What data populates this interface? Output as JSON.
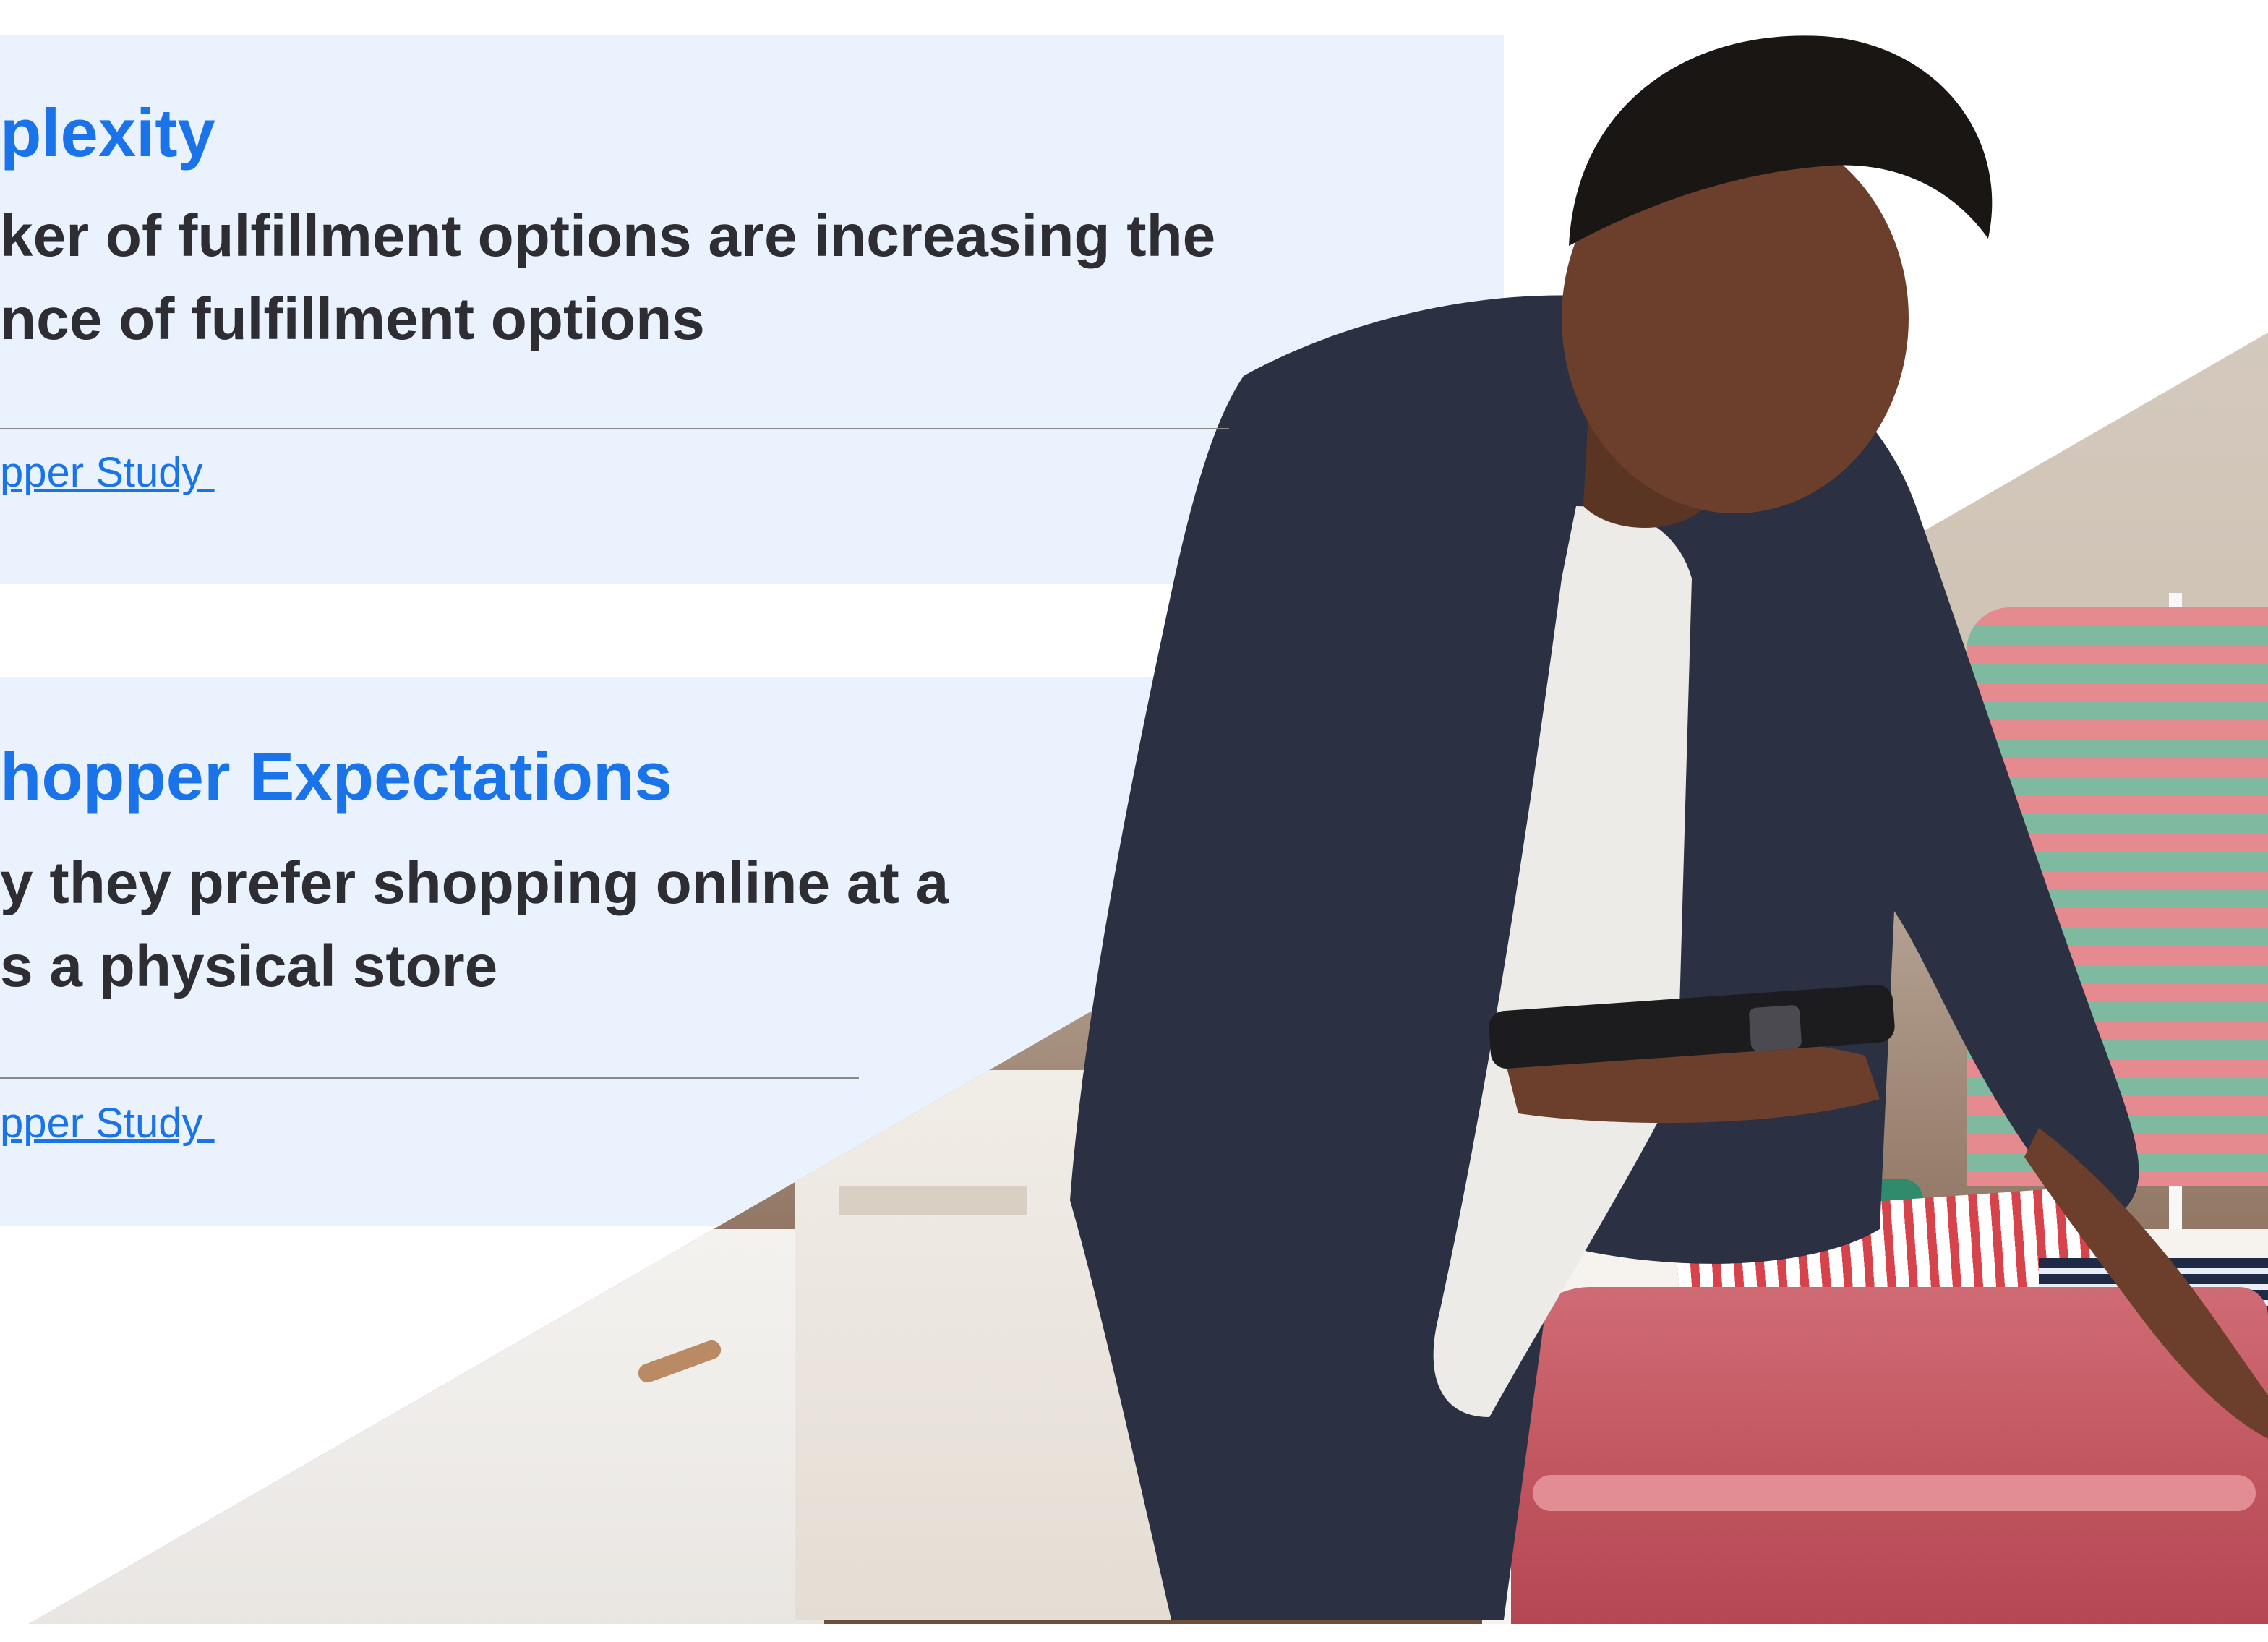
{
  "section1": {
    "heading": "plexity",
    "body_line1": "ker of fulfillment options are increasing the",
    "body_line2": "nce of fulfillment options",
    "source_link": "pper Study "
  },
  "section2": {
    "heading": "hopper Expectations",
    "body_line1": "y they prefer shopping online at a",
    "body_line2": "s a physical store",
    "source_link": "pper Study "
  },
  "colors": {
    "accent": "#1a73e8",
    "card_background": "#eaf3fd",
    "body_text": "#2d2d33",
    "divider": "#8a8a8a"
  }
}
